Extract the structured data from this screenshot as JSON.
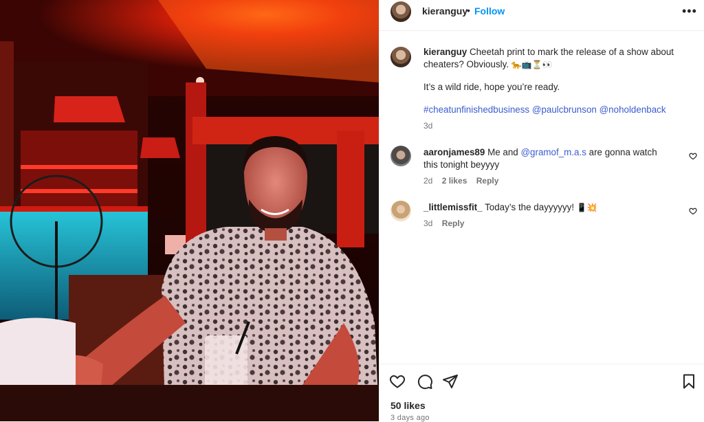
{
  "post": {
    "username": "kieranguy",
    "follow_label": "Follow",
    "separator": "•",
    "more_label": "•••"
  },
  "caption": {
    "username": "kieranguy",
    "text": "Cheetah print to mark the release of a show about cheaters? Obviously.",
    "emojis": "🐆📺⏳👀",
    "line2": "It’s a wild ride, hope you’re ready.",
    "tags": [
      "#cheatunfinishedbusiness",
      "@paulcbrunson",
      "@noholdenback"
    ],
    "age": "3d"
  },
  "comments": [
    {
      "username": "aaronjames89",
      "text_before": "Me and ",
      "mention": "@gramof_m.a.s",
      "text_after": " are gonna watch this tonight beyyyy",
      "age": "2d",
      "likes": "2 likes",
      "reply": "Reply"
    },
    {
      "username": "_littlemissfit_",
      "text": "Today’s the dayyyyyy!",
      "emojis": "📱💥",
      "age": "3d",
      "reply": "Reply"
    }
  ],
  "footer": {
    "likes": "50 likes",
    "date": "3 days ago"
  },
  "colors": {
    "accent": "#0095f6",
    "link": "#3b5ccf",
    "muted": "#737373",
    "text": "#262626"
  }
}
